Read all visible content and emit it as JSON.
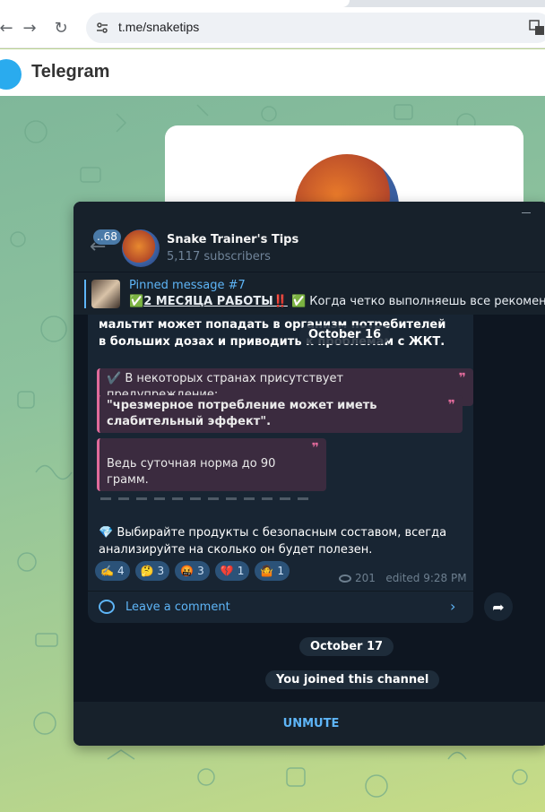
{
  "browser": {
    "url": "t.me/snaketips",
    "back_icon": "arrow-left-icon",
    "forward_icon": "arrow-right-icon",
    "reload_icon": "reload-icon"
  },
  "web_header": {
    "title": "Telegram"
  },
  "window": {
    "channel": {
      "name": "Snake Trainer's Tips",
      "subscribers": "5,117 subscribers",
      "unread": "..68"
    },
    "pinned": {
      "title": "Pinned message #7",
      "text_bold": "2 МЕСЯЦА РАБОТЫ‼️",
      "text_rest": " ✅ Когда четко выполняешь все рекомендации"
    },
    "message": {
      "top_text": "мальтит может попадать в организм потребителей в больших дозах и приводить к проблемам с ЖКТ.",
      "floating_date": "October 16",
      "quote1": "✔️ В некоторых странах присутствует предупреждение:",
      "quote2": "\"чрезмерное потребление может иметь слабительный эффект\".",
      "quote3": "Ведь суточная норма до 90 грамм.",
      "footer_text": "💎 Выбирайте продукты с безопасным составом, всегда анализируйте на сколько он будет полезен.",
      "reactions": [
        {
          "emoji": "✍️",
          "count": "4"
        },
        {
          "emoji": "🤔",
          "count": "3"
        },
        {
          "emoji": "🤬",
          "count": "3"
        },
        {
          "emoji": "💔",
          "count": "1"
        },
        {
          "emoji": "🤷",
          "count": "1"
        }
      ],
      "views": "201",
      "edited": "edited 9:28 PM",
      "comment_label": "Leave a comment"
    },
    "date_pill": "October 17",
    "service_message": "You joined this channel",
    "unmute_label": "UNMUTE"
  }
}
